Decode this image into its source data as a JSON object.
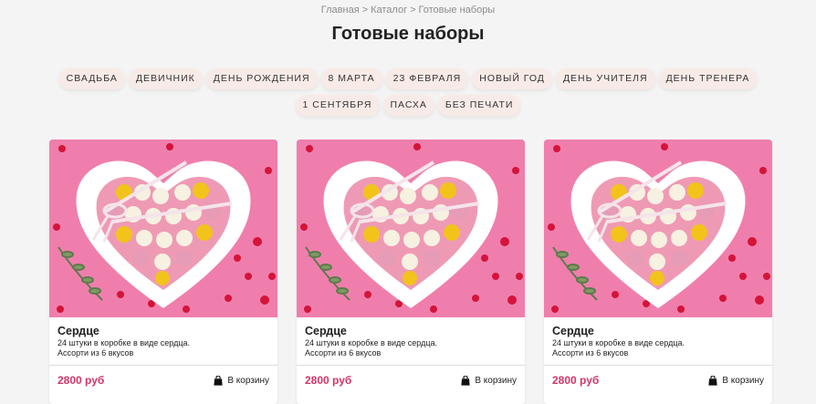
{
  "breadcrumb": {
    "items": [
      "Главная",
      "Каталог",
      "Готовые наборы"
    ],
    "separator": ">"
  },
  "page_title": "Готовые наборы",
  "categories": [
    "Свадьба",
    "Девичник",
    "День рождения",
    "8 марта",
    "23 февраля",
    "Новый год",
    "День учителя",
    "День тренера",
    "1 сентября",
    "Пасха",
    "Без печати"
  ],
  "products": [
    {
      "title": "Сердце",
      "desc_line1": "24 штуки в коробке в виде сердца.",
      "desc_line2": "Ассорти из 6 вкусов",
      "price": "2800 руб",
      "cart_label": "В корзину"
    },
    {
      "title": "Сердце",
      "desc_line1": "24 штуки в коробке в виде сердца.",
      "desc_line2": "Ассорти из 6 вкусов",
      "price": "2800 руб",
      "cart_label": "В корзину"
    },
    {
      "title": "Сердце",
      "desc_line1": "24 штуки в коробке в виде сердца.",
      "desc_line2": "Ассорти из 6 вкусов",
      "price": "2800 руб",
      "cart_label": "В корзину"
    }
  ],
  "colors": {
    "accent_price": "#d43466",
    "chip_bg": "#f8ebe7",
    "photo_bg": "#f07ead"
  },
  "icons": {
    "cart": "shopping-bag-icon"
  }
}
